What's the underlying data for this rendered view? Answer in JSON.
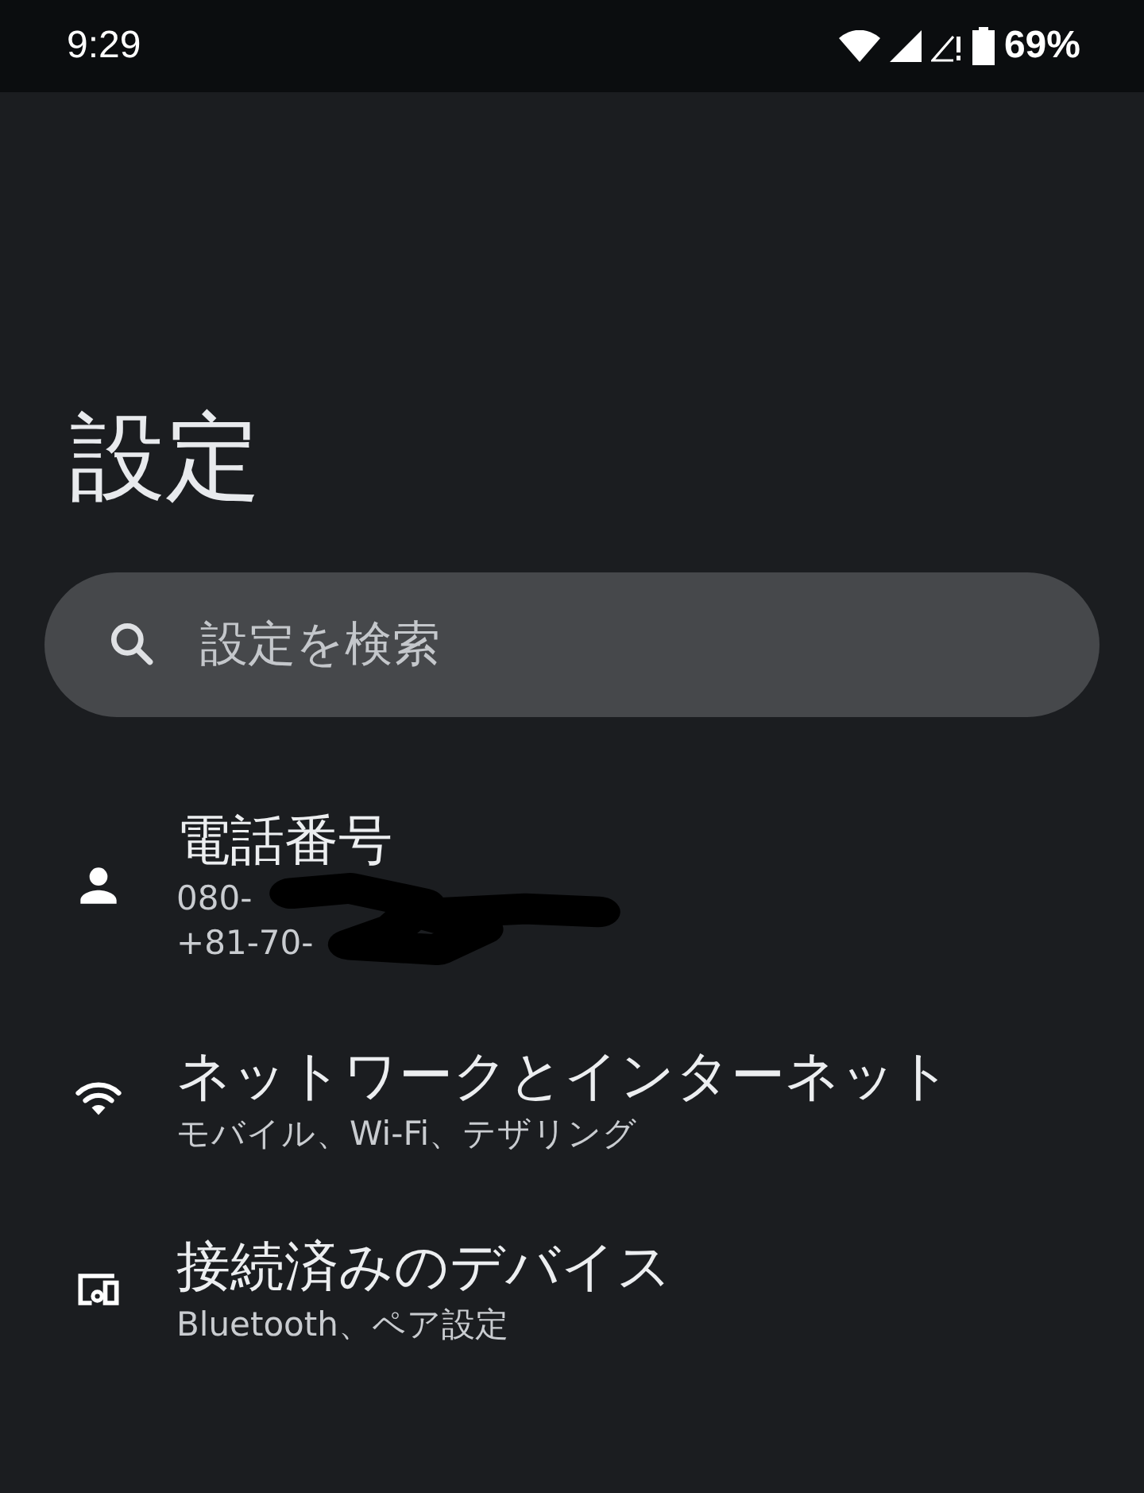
{
  "status_bar": {
    "time": "9:29",
    "battery": "69%"
  },
  "title": "設定",
  "search": {
    "placeholder": "設定を検索"
  },
  "items": [
    {
      "kind": "person",
      "title": "電話番号",
      "details": [
        "080-",
        "+81-70-"
      ],
      "redacted": true
    },
    {
      "kind": "wifi",
      "title": "ネットワークとインターネット",
      "details": [
        "モバイル、Wi-Fi、テザリング"
      ],
      "redacted": false
    },
    {
      "kind": "devices",
      "title": "接続済みのデバイス",
      "details": [
        "Bluetooth、ペア設定"
      ],
      "redacted": false
    }
  ]
}
